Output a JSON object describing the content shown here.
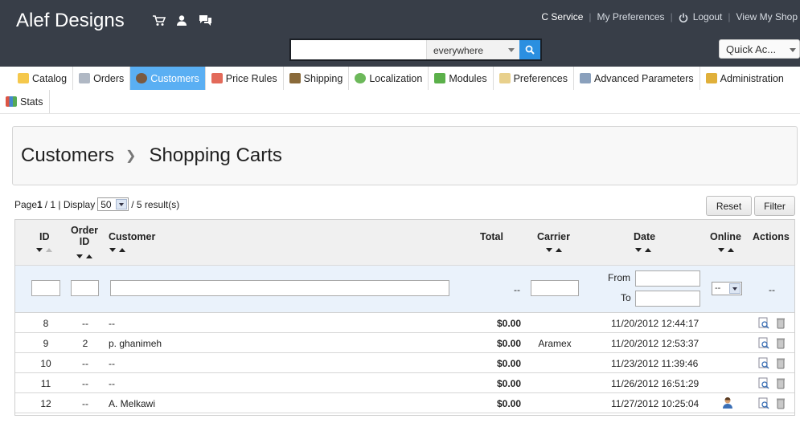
{
  "header": {
    "brand": "Alef Designs",
    "icons": [
      "cart-icon",
      "customer-icon",
      "messages-icon"
    ],
    "links": [
      "C Service",
      "My Preferences",
      "Logout",
      "View My Shop"
    ],
    "search": {
      "value": "",
      "scope": "everywhere"
    },
    "quick_access": "Quick Ac..."
  },
  "menu": {
    "items": [
      {
        "label": "Catalog",
        "icon": "folder-icon",
        "active": false
      },
      {
        "label": "Orders",
        "icon": "cart-icon",
        "active": false
      },
      {
        "label": "Customers",
        "icon": "user-icon",
        "active": true
      },
      {
        "label": "Price Rules",
        "icon": "price-rules-icon",
        "active": false
      },
      {
        "label": "Shipping",
        "icon": "truck-icon",
        "active": false
      },
      {
        "label": "Localization",
        "icon": "globe-icon",
        "active": false
      },
      {
        "label": "Modules",
        "icon": "puzzle-icon",
        "active": false
      },
      {
        "label": "Preferences",
        "icon": "preferences-icon",
        "active": false
      },
      {
        "label": "Advanced Parameters",
        "icon": "wrench-icon",
        "active": false
      },
      {
        "label": "Administration",
        "icon": "key-icon",
        "active": false
      },
      {
        "label": "Stats",
        "icon": "bar-chart-icon",
        "active": false
      }
    ]
  },
  "breadcrumb": {
    "parent": "Customers",
    "current": "Shopping Carts"
  },
  "pagination": {
    "page_prefix": "Page ",
    "page": "1",
    "page_total": " / 1 | Display",
    "per_page": "50",
    "results": "/ 5 result(s)"
  },
  "buttons": {
    "reset": "Reset",
    "filter": "Filter"
  },
  "table": {
    "columns": {
      "id": "ID",
      "order_id_1": "Order",
      "order_id_2": "ID",
      "customer": "Customer",
      "total": "Total",
      "carrier": "Carrier",
      "date": "Date",
      "online": "Online",
      "actions": "Actions"
    },
    "filters": {
      "total": "--",
      "from": "From",
      "to": "To",
      "online_select": "--",
      "actions": "--"
    },
    "rows": [
      {
        "id": "8",
        "order_id": "--",
        "customer": "--",
        "total": "$0.00",
        "carrier": "",
        "date": "11/20/2012 12:44:17",
        "online": false
      },
      {
        "id": "9",
        "order_id": "2",
        "customer": "p. ghanimeh",
        "total": "$0.00",
        "carrier": "Aramex",
        "date": "11/20/2012 12:53:37",
        "online": false
      },
      {
        "id": "10",
        "order_id": "--",
        "customer": "--",
        "total": "$0.00",
        "carrier": "",
        "date": "11/23/2012 11:39:46",
        "online": false
      },
      {
        "id": "11",
        "order_id": "--",
        "customer": "--",
        "total": "$0.00",
        "carrier": "",
        "date": "11/26/2012 16:51:29",
        "online": false
      },
      {
        "id": "12",
        "order_id": "--",
        "customer": "A. Melkawi",
        "total": "$0.00",
        "carrier": "",
        "date": "11/27/2012 10:25:04",
        "online": true
      }
    ]
  }
}
